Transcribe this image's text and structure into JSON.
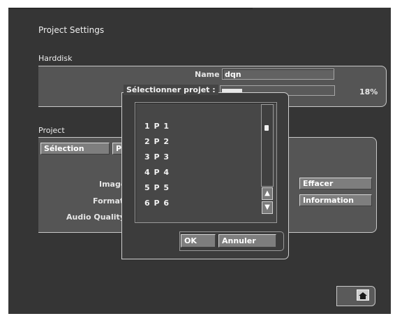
{
  "page": {
    "title": "Project Settings"
  },
  "harddisk": {
    "label": "Harddisk",
    "name_label": "Name",
    "name_value": "dqn",
    "usage_percent_text": "18%",
    "usage_fraction": 0.18
  },
  "project": {
    "label": "Project",
    "tabs": [
      {
        "label": "Sélection"
      },
      {
        "label": "P"
      }
    ],
    "fields": {
      "image_label": "Image",
      "format_label": "Format",
      "audio_label": "Audio Quality"
    },
    "buttons": {
      "delete_label": "Effacer",
      "info_label": "Information"
    }
  },
  "dialog": {
    "title": "Sélectionner projet :",
    "items": [
      "1 P 1",
      "2 P 2",
      "3 P 3",
      "4 P 4",
      "5 P 5",
      "6 P 6"
    ],
    "ok_label": "OK",
    "cancel_label": "Annuler",
    "scroll_up_icon": "chevron-up-icon",
    "scroll_down_icon": "chevron-down-icon"
  },
  "footer": {
    "home_icon": "home-icon"
  }
}
